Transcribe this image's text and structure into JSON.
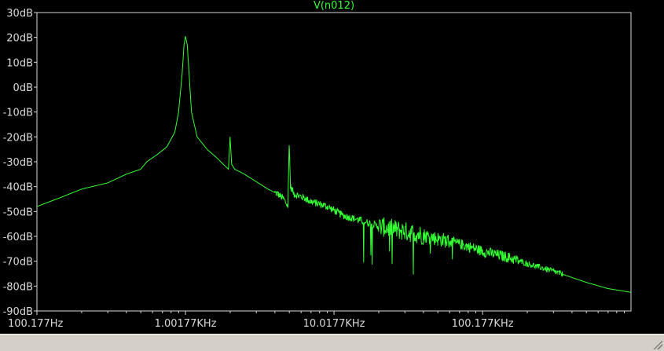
{
  "chart_data": {
    "type": "line",
    "title": "V(n012)",
    "x_scale": "log",
    "xlim_hz": [
      100.177,
      1000000
    ],
    "ylim": [
      -90,
      30
    ],
    "y_tick_values": [
      30,
      20,
      10,
      0,
      -10,
      -20,
      -30,
      -40,
      -50,
      -60,
      -70,
      -80,
      -90
    ],
    "y_tick_labels": [
      "30dB",
      "20dB",
      "10dB",
      "0dB",
      "-10dB",
      "-20dB",
      "-30dB",
      "-40dB",
      "-50dB",
      "-60dB",
      "-70dB",
      "-80dB",
      "-90dB"
    ],
    "x_tick_values": [
      100.177,
      1001.77,
      10017.7,
      100177
    ],
    "x_tick_labels": [
      "100.177Hz",
      "1.00177KHz",
      "10.0177KHz",
      "100.177KHz"
    ],
    "series": [
      {
        "color": "#33ff33",
        "x": [
          100.177,
          150,
          200,
          300,
          400,
          500,
          550,
          650,
          750,
          850,
          900,
          950,
          980,
          1001.77,
          1030,
          1060,
          1100,
          1200,
          1400,
          1600,
          1800,
          1950,
          2000,
          2050,
          2150,
          2500,
          3000,
          3600,
          4200,
          4600,
          4900,
          5000,
          5100,
          5400,
          6000,
          6500,
          7000,
          7500,
          8000,
          9000,
          10017.7,
          11000,
          12000,
          13000,
          15000,
          18000,
          20000,
          25000,
          30000,
          40000,
          50000,
          60000,
          80000,
          100177,
          150000,
          200000,
          300000,
          500000,
          700000,
          1000000
        ],
        "y": [
          -48,
          -44,
          -41,
          -38.5,
          -35,
          -33,
          -30,
          -27,
          -24,
          -18,
          -10,
          5,
          17,
          20.5,
          17,
          5,
          -10,
          -20,
          -25,
          -28,
          -31,
          -33,
          -20,
          -31,
          -33,
          -35,
          -38,
          -41,
          -43,
          -45,
          -48,
          -22,
          -40,
          -43,
          -44,
          -45,
          -46,
          -46.5,
          -47,
          -48,
          -49.5,
          -51,
          -52,
          -52.5,
          -53.5,
          -55,
          -56,
          -57,
          -58,
          -59.5,
          -61,
          -62,
          -64,
          -66,
          -68.5,
          -71,
          -74,
          -78.5,
          -81,
          -82.5
        ]
      }
    ]
  }
}
